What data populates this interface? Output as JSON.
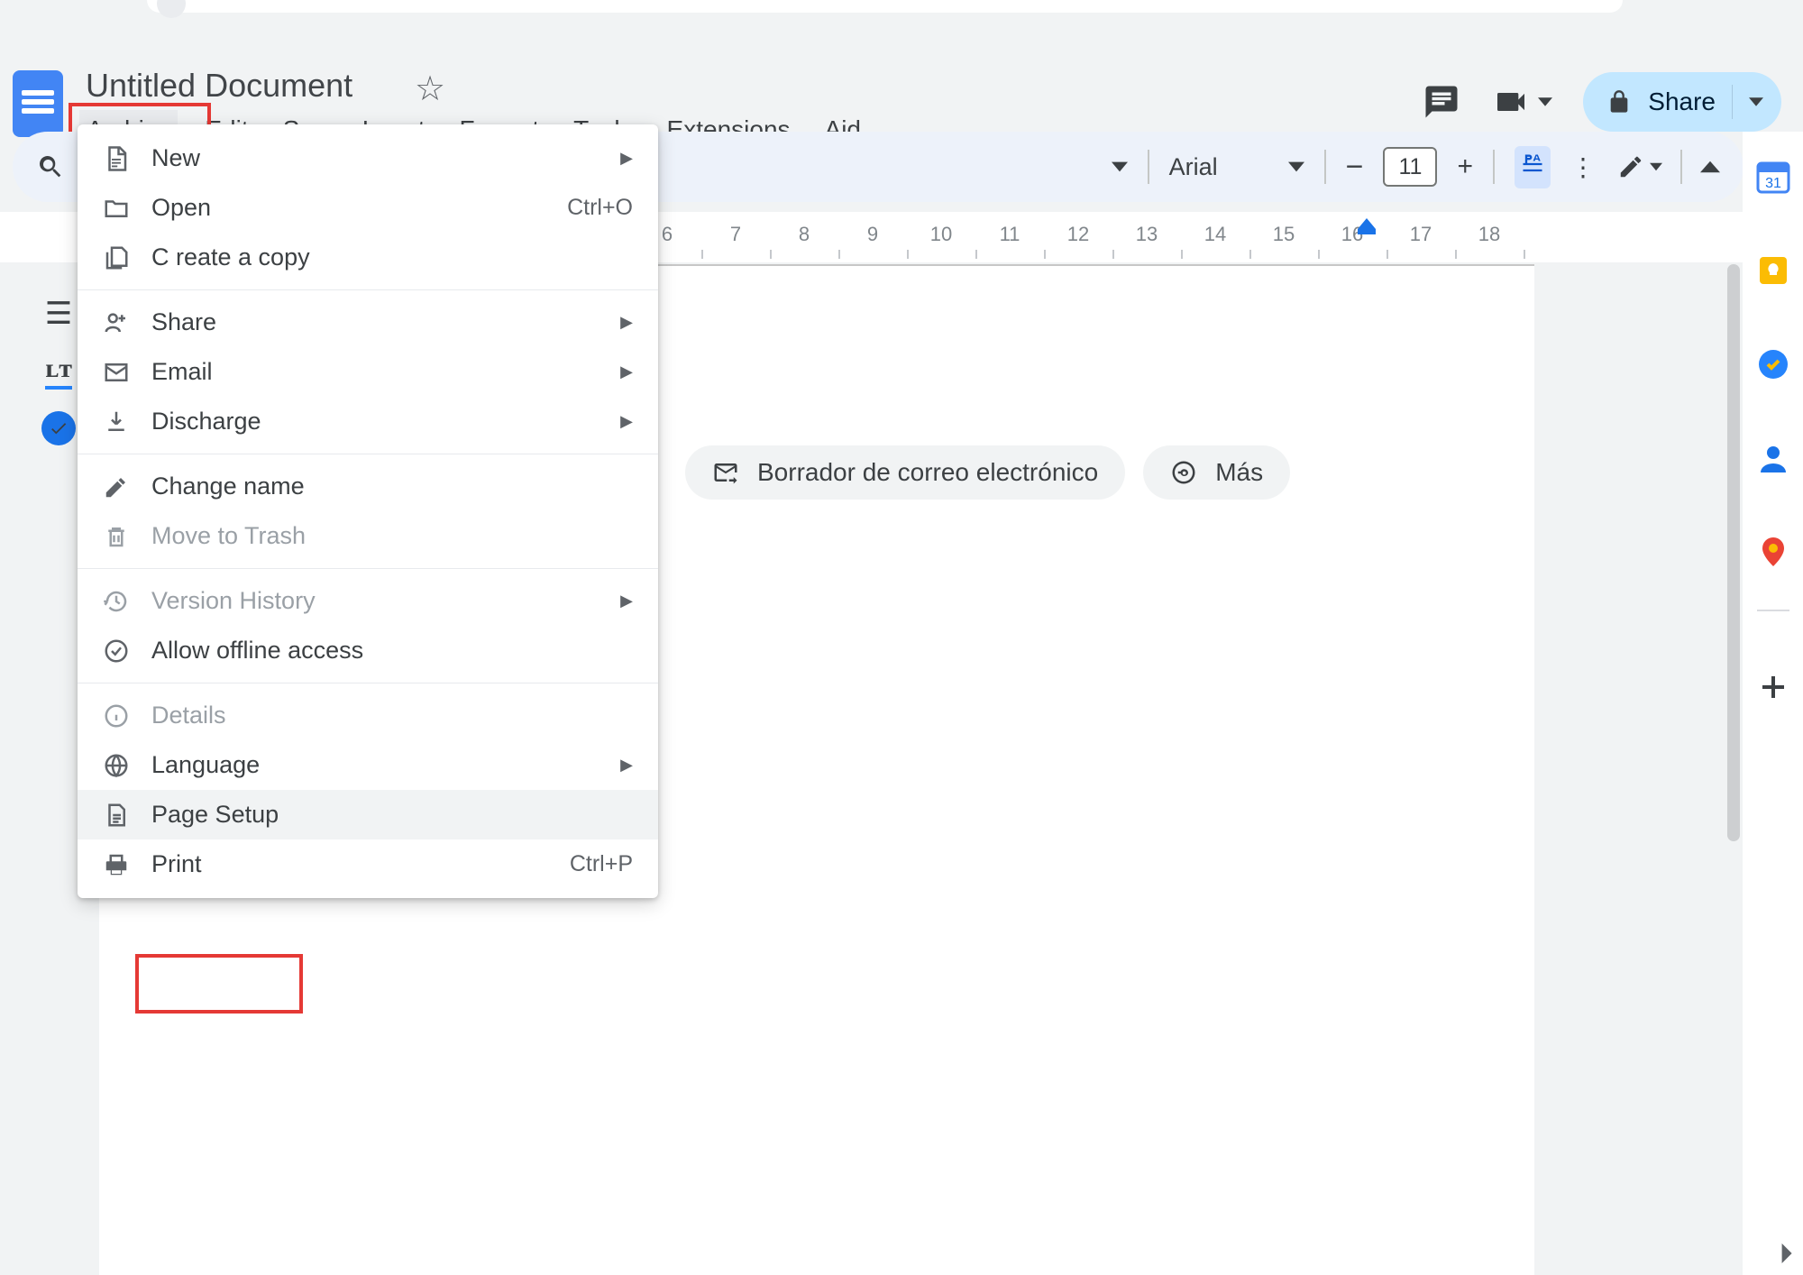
{
  "header": {
    "doc_title": "Untitled Document",
    "share_label": "Share"
  },
  "menubar": {
    "items": [
      "Archive",
      "Edit",
      "See",
      "Insert",
      "Format",
      "Tools",
      "Extensions",
      "Aid"
    ],
    "active_index": 0
  },
  "toolbar": {
    "style_label": "",
    "font_name": "Arial",
    "font_size": "11"
  },
  "ruler": {
    "marks": [
      6,
      7,
      8,
      9,
      10,
      11,
      12,
      13,
      14,
      15,
      16,
      17,
      18
    ]
  },
  "chips": {
    "email_draft": "Borrador de correo electrónico",
    "more": "Más"
  },
  "dropdown": {
    "groups": [
      [
        {
          "id": "new",
          "icon": "doc",
          "label": "New",
          "submenu": true
        },
        {
          "id": "open",
          "icon": "folder",
          "label": "Open",
          "shortcut": "Ctrl+O"
        },
        {
          "id": "copy",
          "icon": "copy",
          "label": "C reate a copy"
        }
      ],
      [
        {
          "id": "share",
          "icon": "share",
          "label": "Share",
          "submenu": true
        },
        {
          "id": "email",
          "icon": "mail",
          "label": "Email",
          "submenu": true
        },
        {
          "id": "discharge",
          "icon": "download",
          "label": "Discharge",
          "submenu": true
        }
      ],
      [
        {
          "id": "rename",
          "icon": "rename",
          "label": "Change name"
        },
        {
          "id": "trash",
          "icon": "trash",
          "label": "Move to Trash",
          "disabled": true
        }
      ],
      [
        {
          "id": "history",
          "icon": "history",
          "label": "Version History",
          "submenu": true,
          "disabled": true
        },
        {
          "id": "offline",
          "icon": "offline",
          "label": "Allow offline access"
        }
      ],
      [
        {
          "id": "details",
          "icon": "info",
          "label": "Details",
          "disabled": true
        },
        {
          "id": "language",
          "icon": "globe",
          "label": "Language",
          "submenu": true
        },
        {
          "id": "pagesetup",
          "icon": "page",
          "label": "Page Setup",
          "hovered": true
        },
        {
          "id": "print",
          "icon": "print",
          "label": "Print",
          "shortcut": "Ctrl+P"
        }
      ]
    ]
  }
}
